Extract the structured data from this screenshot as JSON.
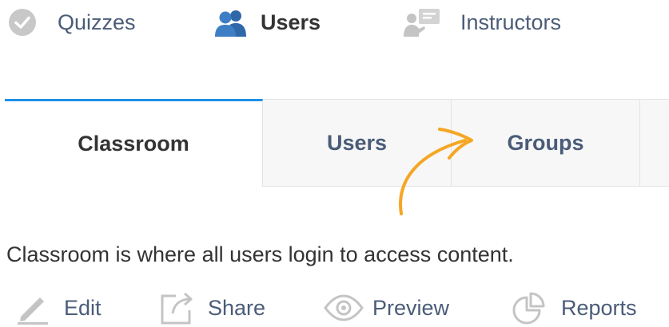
{
  "topnav": {
    "items": [
      {
        "label": "Quizzes",
        "icon": "check-circle-icon",
        "active": false
      },
      {
        "label": "Users",
        "icon": "users-icon",
        "active": true
      },
      {
        "label": "Instructors",
        "icon": "instructor-icon",
        "active": false
      }
    ]
  },
  "tabs": [
    {
      "label": "Classroom",
      "active": true
    },
    {
      "label": "Users",
      "active": false
    },
    {
      "label": "Groups",
      "active": false
    }
  ],
  "description": "Classroom is where all users login to access content.",
  "actions": [
    {
      "label": "Edit",
      "icon": "pencil-icon"
    },
    {
      "label": "Share",
      "icon": "share-icon"
    },
    {
      "label": "Preview",
      "icon": "eye-icon"
    },
    {
      "label": "Reports",
      "icon": "pie-chart-icon"
    }
  ],
  "colors": {
    "link": "#4a5c78",
    "text": "#333333",
    "tab_accent": "#1e90e8",
    "tab_bg": "#f7f7f7",
    "annotation_arrow": "#f5a623",
    "icon_gray": "#c4c4c4"
  }
}
